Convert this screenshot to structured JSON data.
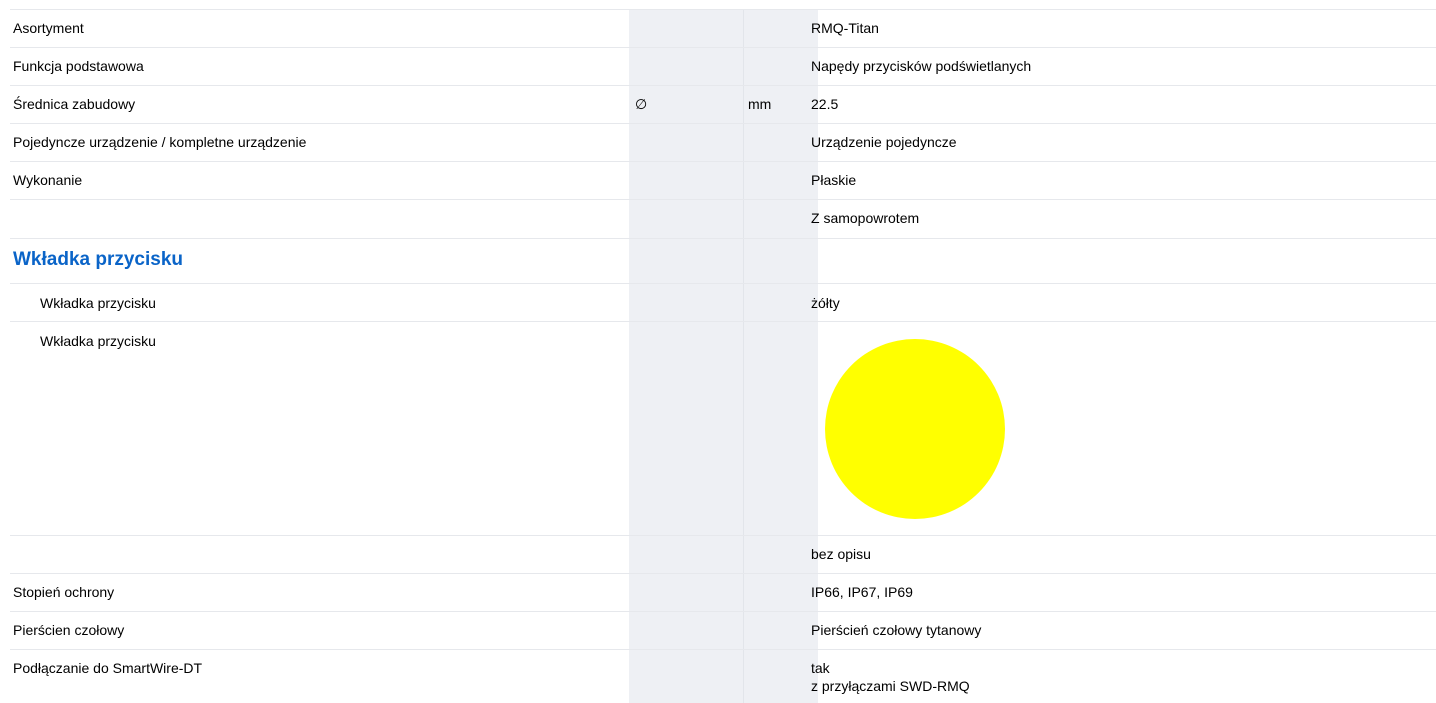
{
  "rows": [
    {
      "label": "Asortyment",
      "value": "RMQ-Titan"
    },
    {
      "label": "Funkcja podstawowa",
      "value": "Napędy przycisków podświetlanych"
    },
    {
      "label": "Średnica zabudowy",
      "symbol": "∅",
      "unit": "mm",
      "value": "22.5"
    },
    {
      "label": "Pojedyncze urządzenie / kompletne urządzenie",
      "value": "Urządzenie pojedyncze"
    },
    {
      "label": "Wykonanie",
      "value": "Płaskie"
    },
    {
      "label": "",
      "value": "Z samopowrotem"
    },
    {
      "label": "Wkładka przycisku",
      "value": "żółty"
    },
    {
      "label": "Wkładka przycisku",
      "swatch_color": "#ffff00"
    },
    {
      "label": "",
      "value": "bez opisu"
    },
    {
      "label": "Stopień ochrony",
      "value": "IP66, IP67, IP69"
    },
    {
      "label": "Pierścien czołowy",
      "value": "Pierścień czołowy tytanowy"
    },
    {
      "label": "Podłączanie do SmartWire-DT",
      "value": "tak",
      "value2": "z przyłączami SWD-RMQ"
    }
  ],
  "section_title": "Wkładka przycisku",
  "colors": {
    "heading": "#0a64c8",
    "gray_column": "#eef0f4",
    "swatch": "#ffff00"
  }
}
